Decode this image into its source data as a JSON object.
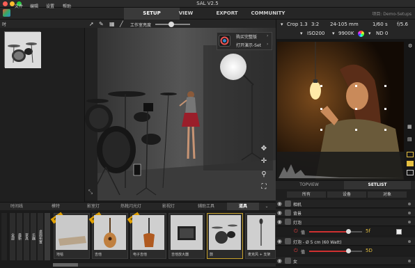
{
  "app": {
    "title": "SAL V2.5",
    "project_label": "项目: Demo-Setups"
  },
  "menu": {
    "items": [
      "文件",
      "编辑",
      "设置",
      "帮助"
    ]
  },
  "main_tabs": [
    "SETUP",
    "VIEW",
    "EXPORT",
    "COMMUNITY"
  ],
  "active_tab": "SETUP",
  "left_panel": {
    "header": "时"
  },
  "viewport_toolbar": {
    "room_brightness_label": "工作室亮度",
    "room_brightness_level": 0.45
  },
  "context_menu": {
    "items": [
      "购买完整版",
      "打开演示-Set"
    ]
  },
  "camera_bar": {
    "crop": "Crop 1.3",
    "ratio": "3:2",
    "lens": "24-105 mm",
    "shutter": "1/60 s",
    "aperture": "f/5.6",
    "iso": "ISO200",
    "white_balance": "9900K",
    "nd": "ND 0"
  },
  "right_tabs": [
    "TOPVIEW",
    "SETLIST"
  ],
  "active_right_tab": "SETLIST",
  "setlist_filters": [
    "所有",
    "设备",
    "对象"
  ],
  "setlist_rows": [
    {
      "label": "相机",
      "kind": "camera"
    },
    {
      "label": "背景",
      "kind": "background"
    },
    {
      "label": "灯泡",
      "kind": "light"
    },
    {
      "label": "灯泡 - Ø 5 cm (60 Watt)",
      "kind": "light"
    },
    {
      "label": "女",
      "kind": "person"
    }
  ],
  "sliders": [
    {
      "label": "值",
      "value_text": "5f"
    },
    {
      "label": "值",
      "value_text": "5D"
    }
  ],
  "library_tabs": [
    "时间线",
    "模特",
    "影室灯",
    "热靴闪光灯",
    "影视灯",
    "辅助工具",
    "道具"
  ],
  "active_library_tab": "道具",
  "library_categories": [
    "全部",
    "最新",
    "家具",
    "乐器",
    "桌面布置"
  ],
  "library_items": [
    {
      "name": "地毯",
      "new": true
    },
    {
      "name": "吉他",
      "new": true
    },
    {
      "name": "电子吉他",
      "new": true
    },
    {
      "name": "吉他放大器",
      "new": false
    },
    {
      "name": "鼓",
      "new": false,
      "selected": true
    },
    {
      "name": "麦克风 + 支架",
      "new": false
    }
  ],
  "new_badge": "NEW",
  "colors": {
    "accent_red": "#d03030",
    "accent_yellow": "#e6c040",
    "selection_gold": "#c9a32c"
  }
}
